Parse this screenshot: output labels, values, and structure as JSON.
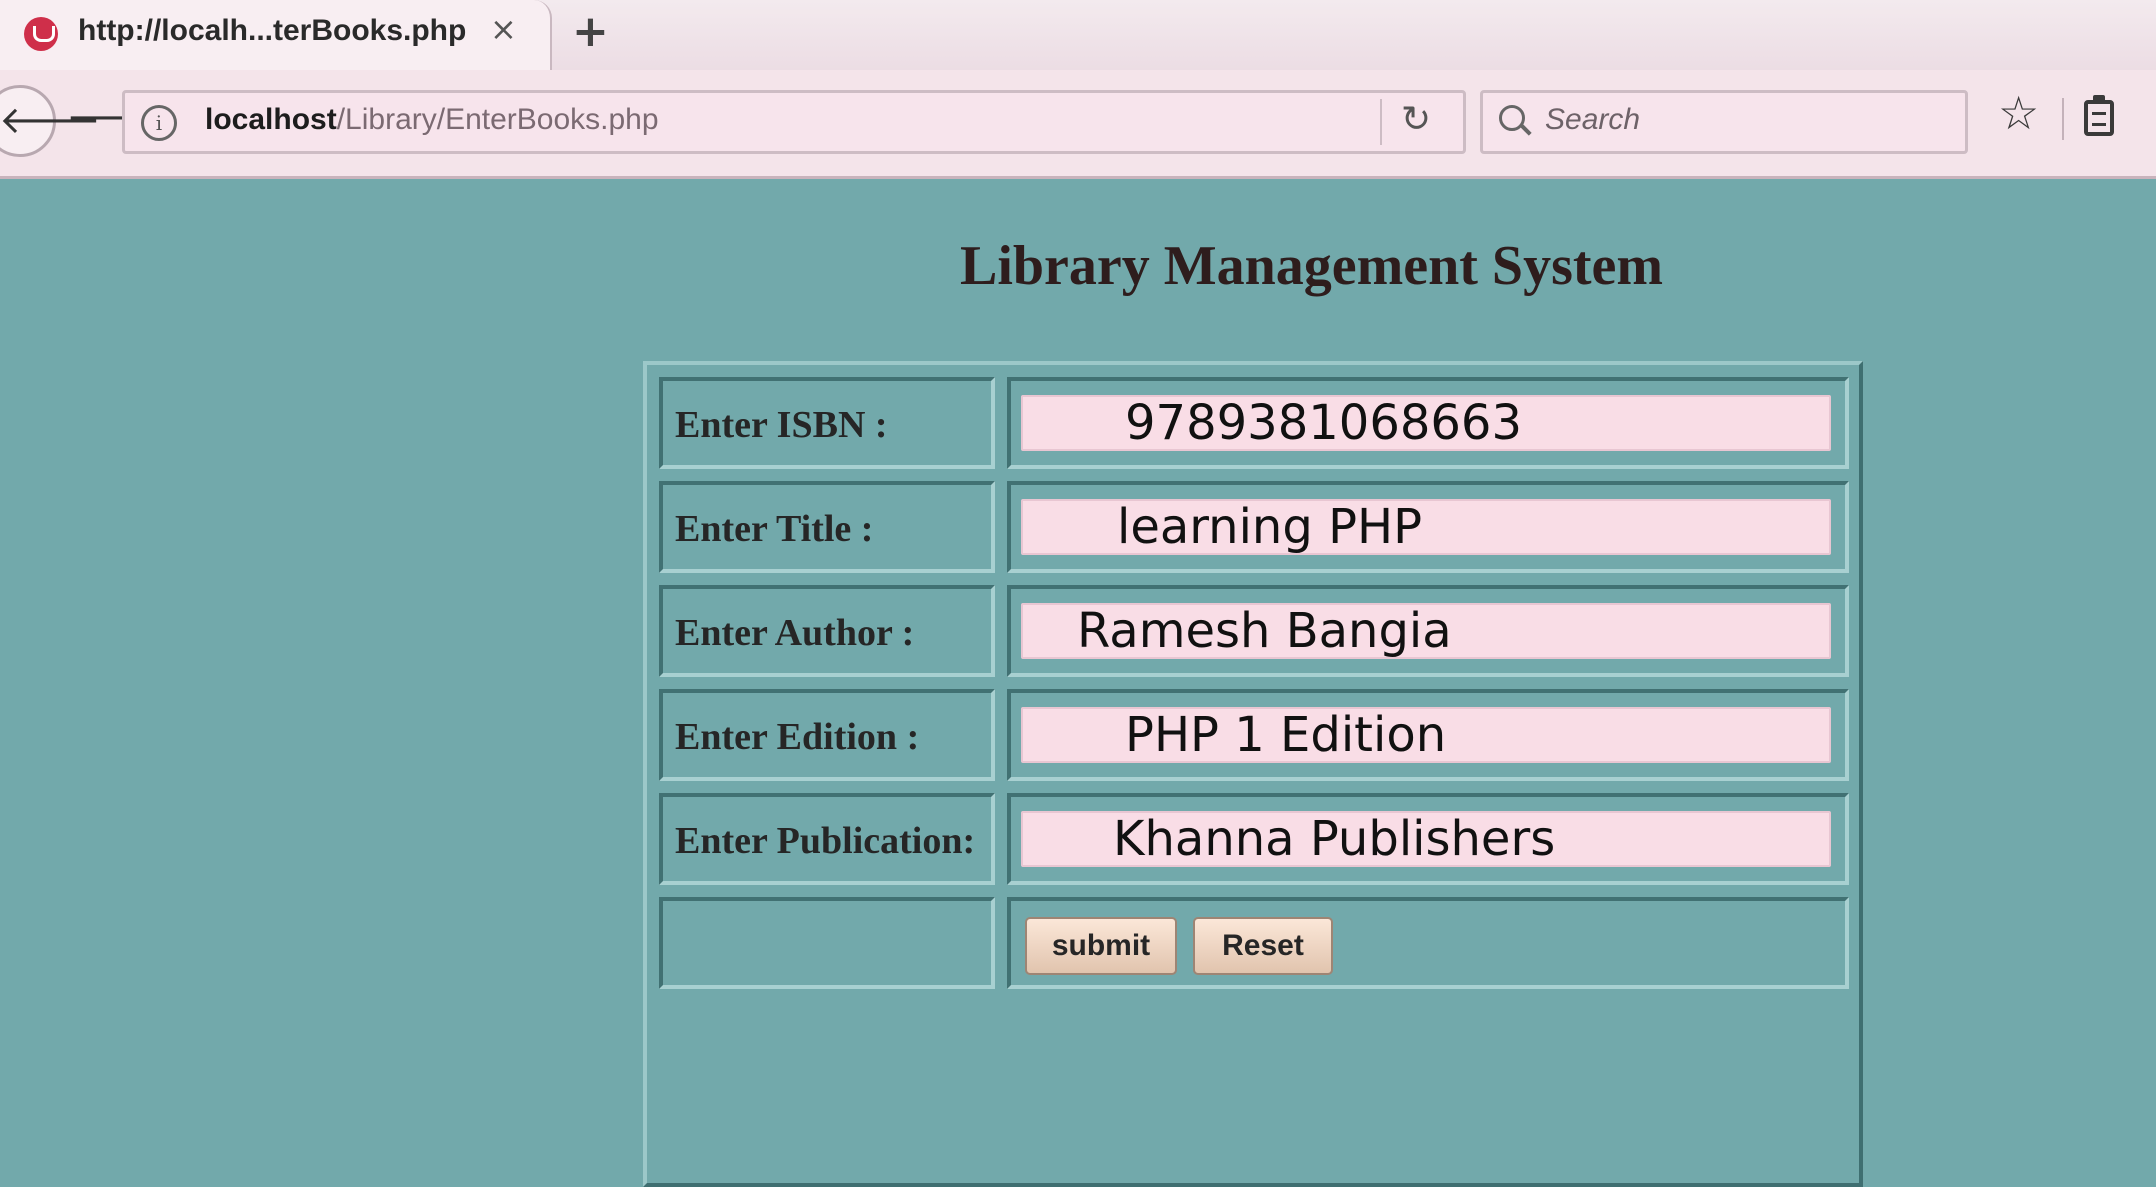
{
  "browser": {
    "tab_title": "http://localh...terBooks.php",
    "tab_close": "×",
    "new_tab": "+",
    "url_host": "localhost",
    "url_path": "/Library/EnterBooks.php",
    "search_placeholder": "Search",
    "icons": {
      "back": "arrow-left-icon",
      "forward": "arrow-right-icon",
      "info": "info-icon",
      "reload": "reload-icon",
      "search": "search-icon",
      "bookmark": "star-icon",
      "clipboard": "clipboard-icon"
    }
  },
  "page": {
    "title": "Library Management System",
    "background_color": "#72a9ab"
  },
  "form": {
    "fields": [
      {
        "label": "Enter ISBN :",
        "value": "9789381068663"
      },
      {
        "label": "Enter Title :",
        "value": "learning PHP"
      },
      {
        "label": "Enter Author :",
        "value": "Ramesh Bangia"
      },
      {
        "label": "Enter Edition :",
        "value": "PHP 1 Edition"
      },
      {
        "label": "Enter Publication:",
        "value": "Khanna Publishers"
      }
    ],
    "submit_label": "submit",
    "reset_label": "Reset"
  }
}
